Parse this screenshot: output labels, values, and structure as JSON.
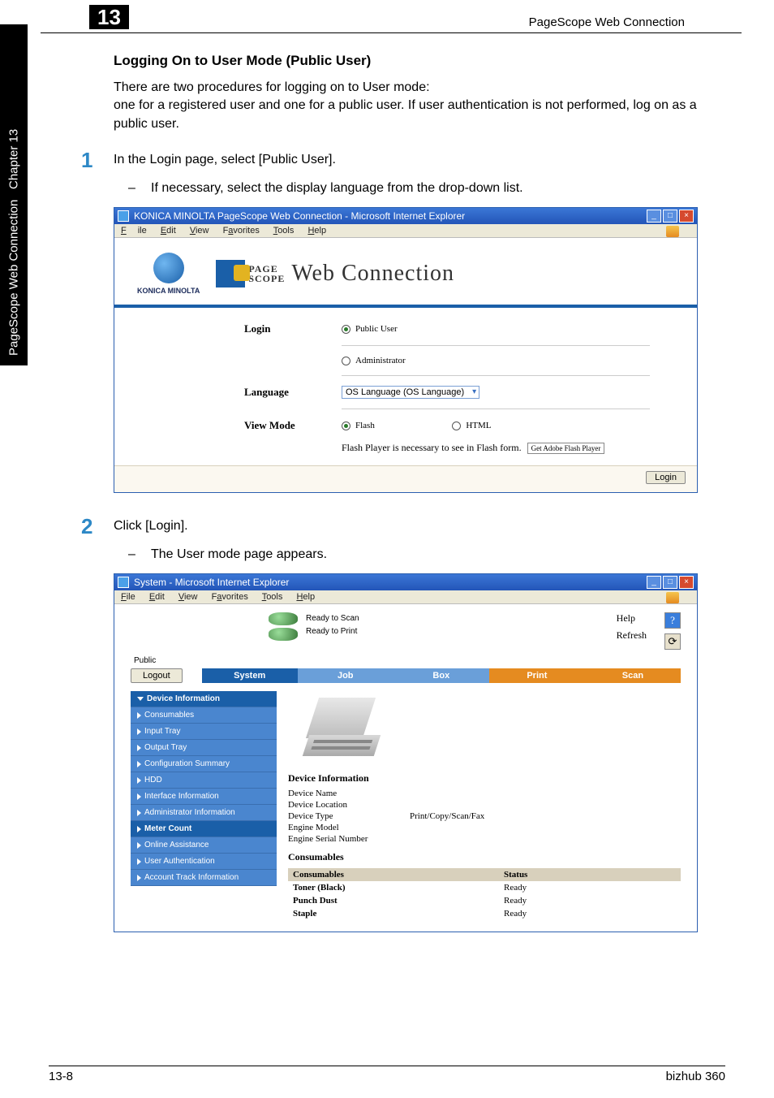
{
  "sidebar": {
    "line1": "PageScope Web Connection",
    "line2": "Chapter 13"
  },
  "header": {
    "chapter_num": "13",
    "title": "PageScope Web Connection"
  },
  "section_title": "Logging On to User Mode (Public User)",
  "intro": "There are two procedures for logging on to User mode:\none for a registered user and one for a public user. If user authentication is not performed, log on as a public user.",
  "step1": {
    "num": "1",
    "text": "In the Login page, select [Public User].",
    "sub": "If necessary, select the display language from the drop-down list."
  },
  "step2": {
    "num": "2",
    "text": "Click [Login].",
    "sub": "The User mode page appears."
  },
  "win1": {
    "title": "KONICA MINOLTA PageScope Web Connection - Microsoft Internet Explorer",
    "menus": {
      "file": "File",
      "edit": "Edit",
      "view": "View",
      "favorites": "Favorites",
      "tools": "Tools",
      "help": "Help"
    },
    "logo_text": "KONICA MINOLTA",
    "ps_stack1": "PAGE",
    "ps_stack2": "SCOPE",
    "ps_web": "Web Connection",
    "login_label": "Login",
    "public_user": "Public User",
    "administrator": "Administrator",
    "language_label": "Language",
    "language_value": "OS Language (OS Language)",
    "viewmode_label": "View Mode",
    "flash": "Flash",
    "html": "HTML",
    "flash_note": "Flash Player is necessary to see in Flash form.",
    "flash_badge": "Get Adobe Flash Player",
    "login_btn": "Login"
  },
  "win2": {
    "title": "System - Microsoft Internet Explorer",
    "menus": {
      "file": "File",
      "edit": "Edit",
      "view": "View",
      "favorites": "Favorites",
      "tools": "Tools",
      "help": "Help"
    },
    "status1": "Ready to Scan",
    "status2": "Ready to Print",
    "help": "Help",
    "refresh": "Refresh",
    "public": "Public",
    "logout": "Logout",
    "tabs": {
      "system": "System",
      "job": "Job",
      "box": "Box",
      "print": "Print",
      "scan": "Scan"
    },
    "side": {
      "dev_info": "Device Information",
      "consumables": "Consumables",
      "input_tray": "Input Tray",
      "output_tray": "Output Tray",
      "config_summary": "Configuration Summary",
      "hdd": "HDD",
      "interface_info": "Interface Information",
      "admin_info": "Administrator Information",
      "meter_count": "Meter Count",
      "online_assist": "Online Assistance",
      "user_auth": "User Authentication",
      "acct_track": "Account Track Information"
    },
    "dev_info_title": "Device Information",
    "dev_name": "Device Name",
    "dev_location": "Device Location",
    "dev_type": "Device Type",
    "dev_type_val": "Print/Copy/Scan/Fax",
    "engine_model": "Engine Model",
    "engine_serial": "Engine Serial Number",
    "cons_title": "Consumables",
    "cons_h1": "Consumables",
    "cons_h2": "Status",
    "rows": [
      {
        "name": "Toner (Black)",
        "status": "Ready"
      },
      {
        "name": "Punch Dust",
        "status": "Ready"
      },
      {
        "name": "Staple",
        "status": "Ready"
      }
    ]
  },
  "footer": {
    "left": "13-8",
    "right": "bizhub 360"
  }
}
